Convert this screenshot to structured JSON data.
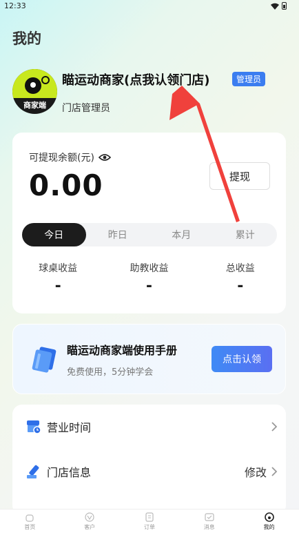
{
  "status": {
    "time": "12:33"
  },
  "page": {
    "title": "我的"
  },
  "profile": {
    "store_name": "瞄运动商家(点我认领门店)",
    "badge": "管理员",
    "role": "门店管理员",
    "avatar_text": "商家端"
  },
  "balance": {
    "label": "可提现余额(元)",
    "amount": "0.00",
    "withdraw_label": "提现",
    "tabs": [
      "今日",
      "昨日",
      "本月",
      "累计"
    ],
    "active_tab": "今日",
    "stats": [
      {
        "label": "球桌收益",
        "value": "-"
      },
      {
        "label": "助教收益",
        "value": "-"
      },
      {
        "label": "总收益",
        "value": "-"
      }
    ]
  },
  "manual": {
    "title": "瞄运动商家端使用手册",
    "subtitle": "免费使用，5分钟学会",
    "button": "点击认领"
  },
  "menu": {
    "items": [
      {
        "label": "营业时间",
        "value": "",
        "icon": "store-clock-icon"
      },
      {
        "label": "门店信息",
        "value": "修改",
        "icon": "pen-icon"
      }
    ]
  },
  "tabbar": {
    "items": [
      {
        "label": "首页",
        "icon": "home-icon"
      },
      {
        "label": "客户",
        "icon": "customer-icon"
      },
      {
        "label": "订单",
        "icon": "order-icon"
      },
      {
        "label": "消息",
        "icon": "message-icon"
      },
      {
        "label": "我的",
        "icon": "profile-icon"
      }
    ],
    "active": "我的"
  },
  "colors": {
    "accent": "#3b7df0",
    "arrow": "#f0413c",
    "lime": "#c8e81e"
  }
}
